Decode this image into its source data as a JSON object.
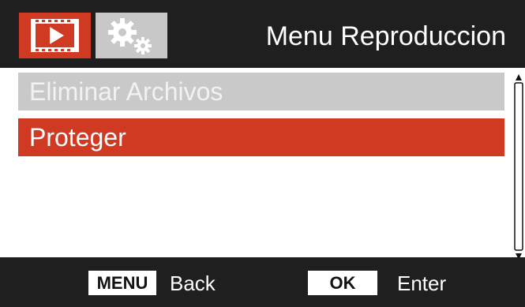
{
  "header": {
    "title": "Menu Reproduccion",
    "tabs": [
      {
        "icon": "play-video-icon",
        "active": true
      },
      {
        "icon": "settings-gears-icon",
        "active": false
      }
    ]
  },
  "menu": {
    "items": [
      {
        "label": "Eliminar Archivos",
        "state": "disabled"
      },
      {
        "label": "Proteger",
        "state": "selected"
      }
    ]
  },
  "footer": {
    "menu_key": "MENU",
    "menu_action": "Back",
    "ok_key": "OK",
    "ok_action": "Enter"
  },
  "colors": {
    "accent": "#d13a22",
    "header_bg": "#1f1f1f",
    "inactive_tab": "#c8c8c8",
    "disabled_item": "#c9c9c9"
  }
}
